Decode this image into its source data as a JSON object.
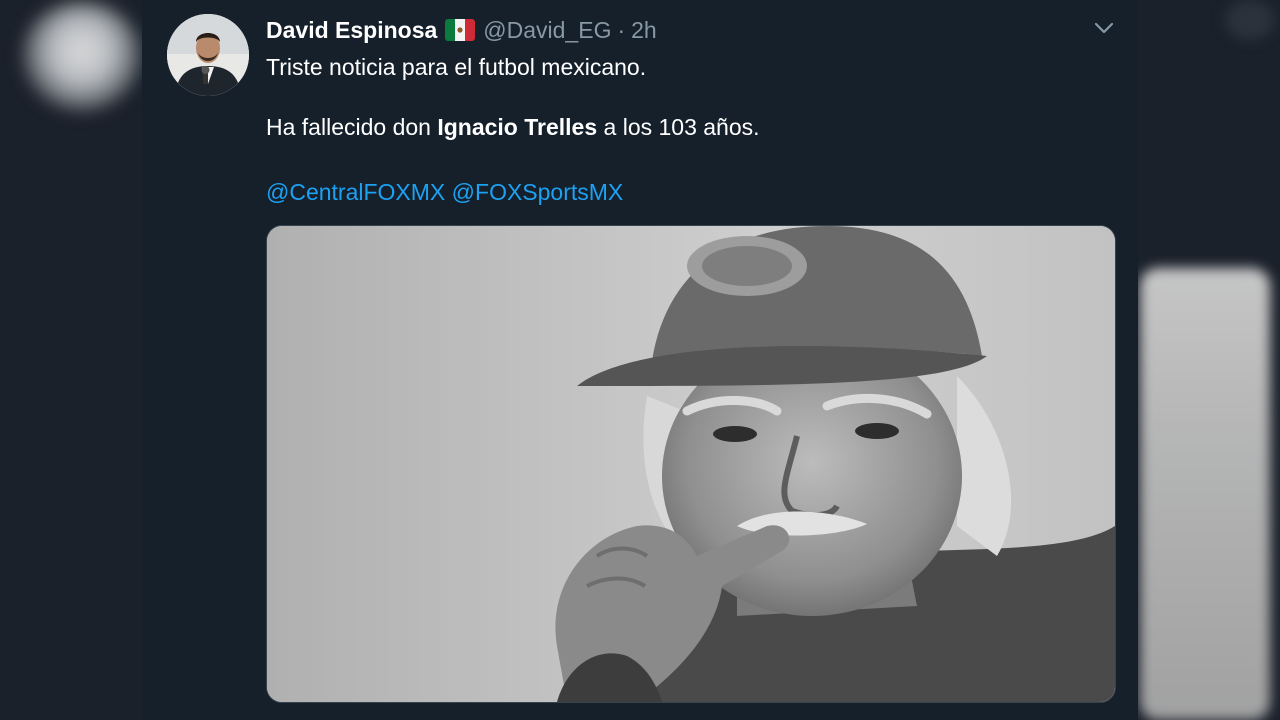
{
  "tweet": {
    "author_name": "David Espinosa",
    "handle": "@David_EG",
    "separator": "·",
    "time": "2h",
    "line1": "Triste noticia para el futbol mexicano.",
    "line2_prefix": "Ha fallecido don ",
    "line2_bold": "Ignacio Trelles",
    "line2_suffix": " a los 103 años.",
    "mentions": [
      "@CentralFOXMX",
      "@FOXSportsMX"
    ]
  },
  "icons": {
    "flag": "mexico-flag-icon",
    "menu": "chevron-down-icon"
  },
  "colors": {
    "background": "#15202b",
    "text": "#ffffff",
    "secondary_text": "#8899a6",
    "link": "#1da1f2"
  }
}
